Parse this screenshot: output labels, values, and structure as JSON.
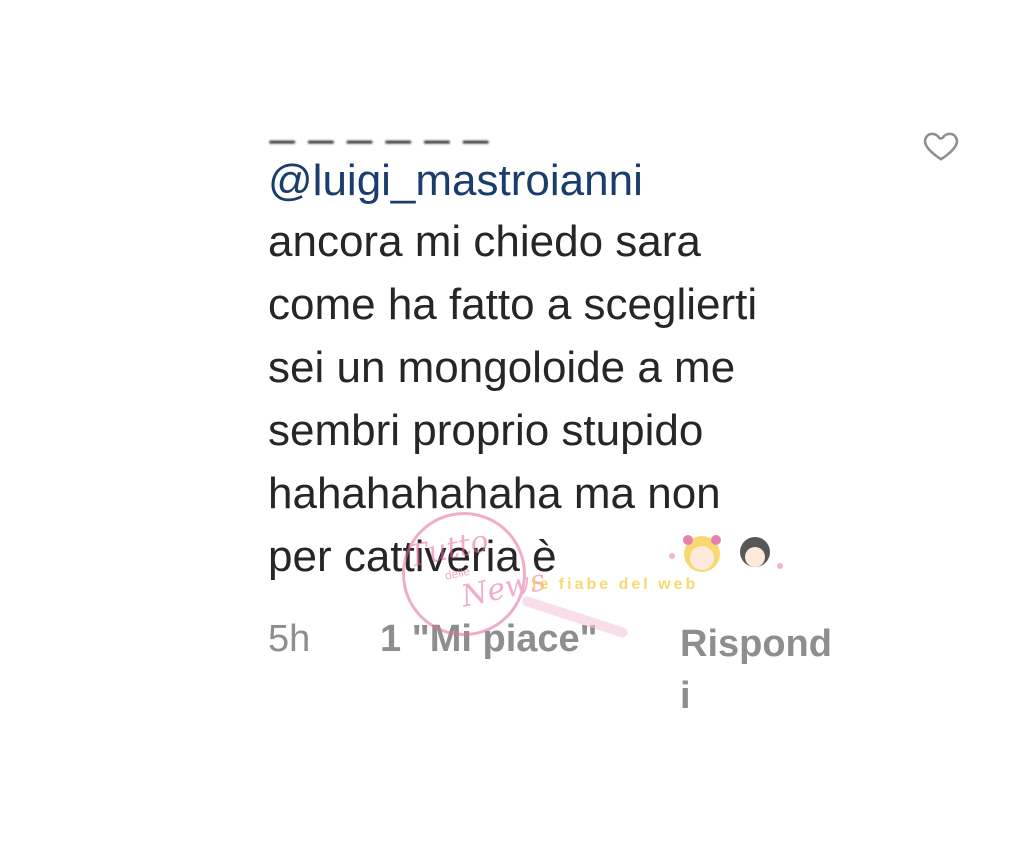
{
  "comment": {
    "username_cropped": "_ _ _  _ _ _",
    "mention": "@luigi_mastroianni",
    "lines": [
      "ancora mi chiedo sara",
      "come ha fatto a sceglierti",
      "sei un mongoloide a me",
      "sembri proprio stupido",
      "hahahahahaha ma non",
      "per cattiveria è"
    ],
    "time": "5h",
    "likes": "1 \"Mi piace\"",
    "reply": "Rispondi"
  },
  "icons": {
    "like": "heart-outline-icon"
  },
  "watermark": {
    "circle_line1": "Tutto",
    "circle_line2": "News",
    "circle_small": "delle",
    "banner": "le fiabe del web"
  },
  "colors": {
    "mention": "#1a3d6d",
    "text": "#262626",
    "meta": "#8e8e8e",
    "watermark_pink": "#e46aa2",
    "watermark_yellow": "#f6d35a"
  }
}
